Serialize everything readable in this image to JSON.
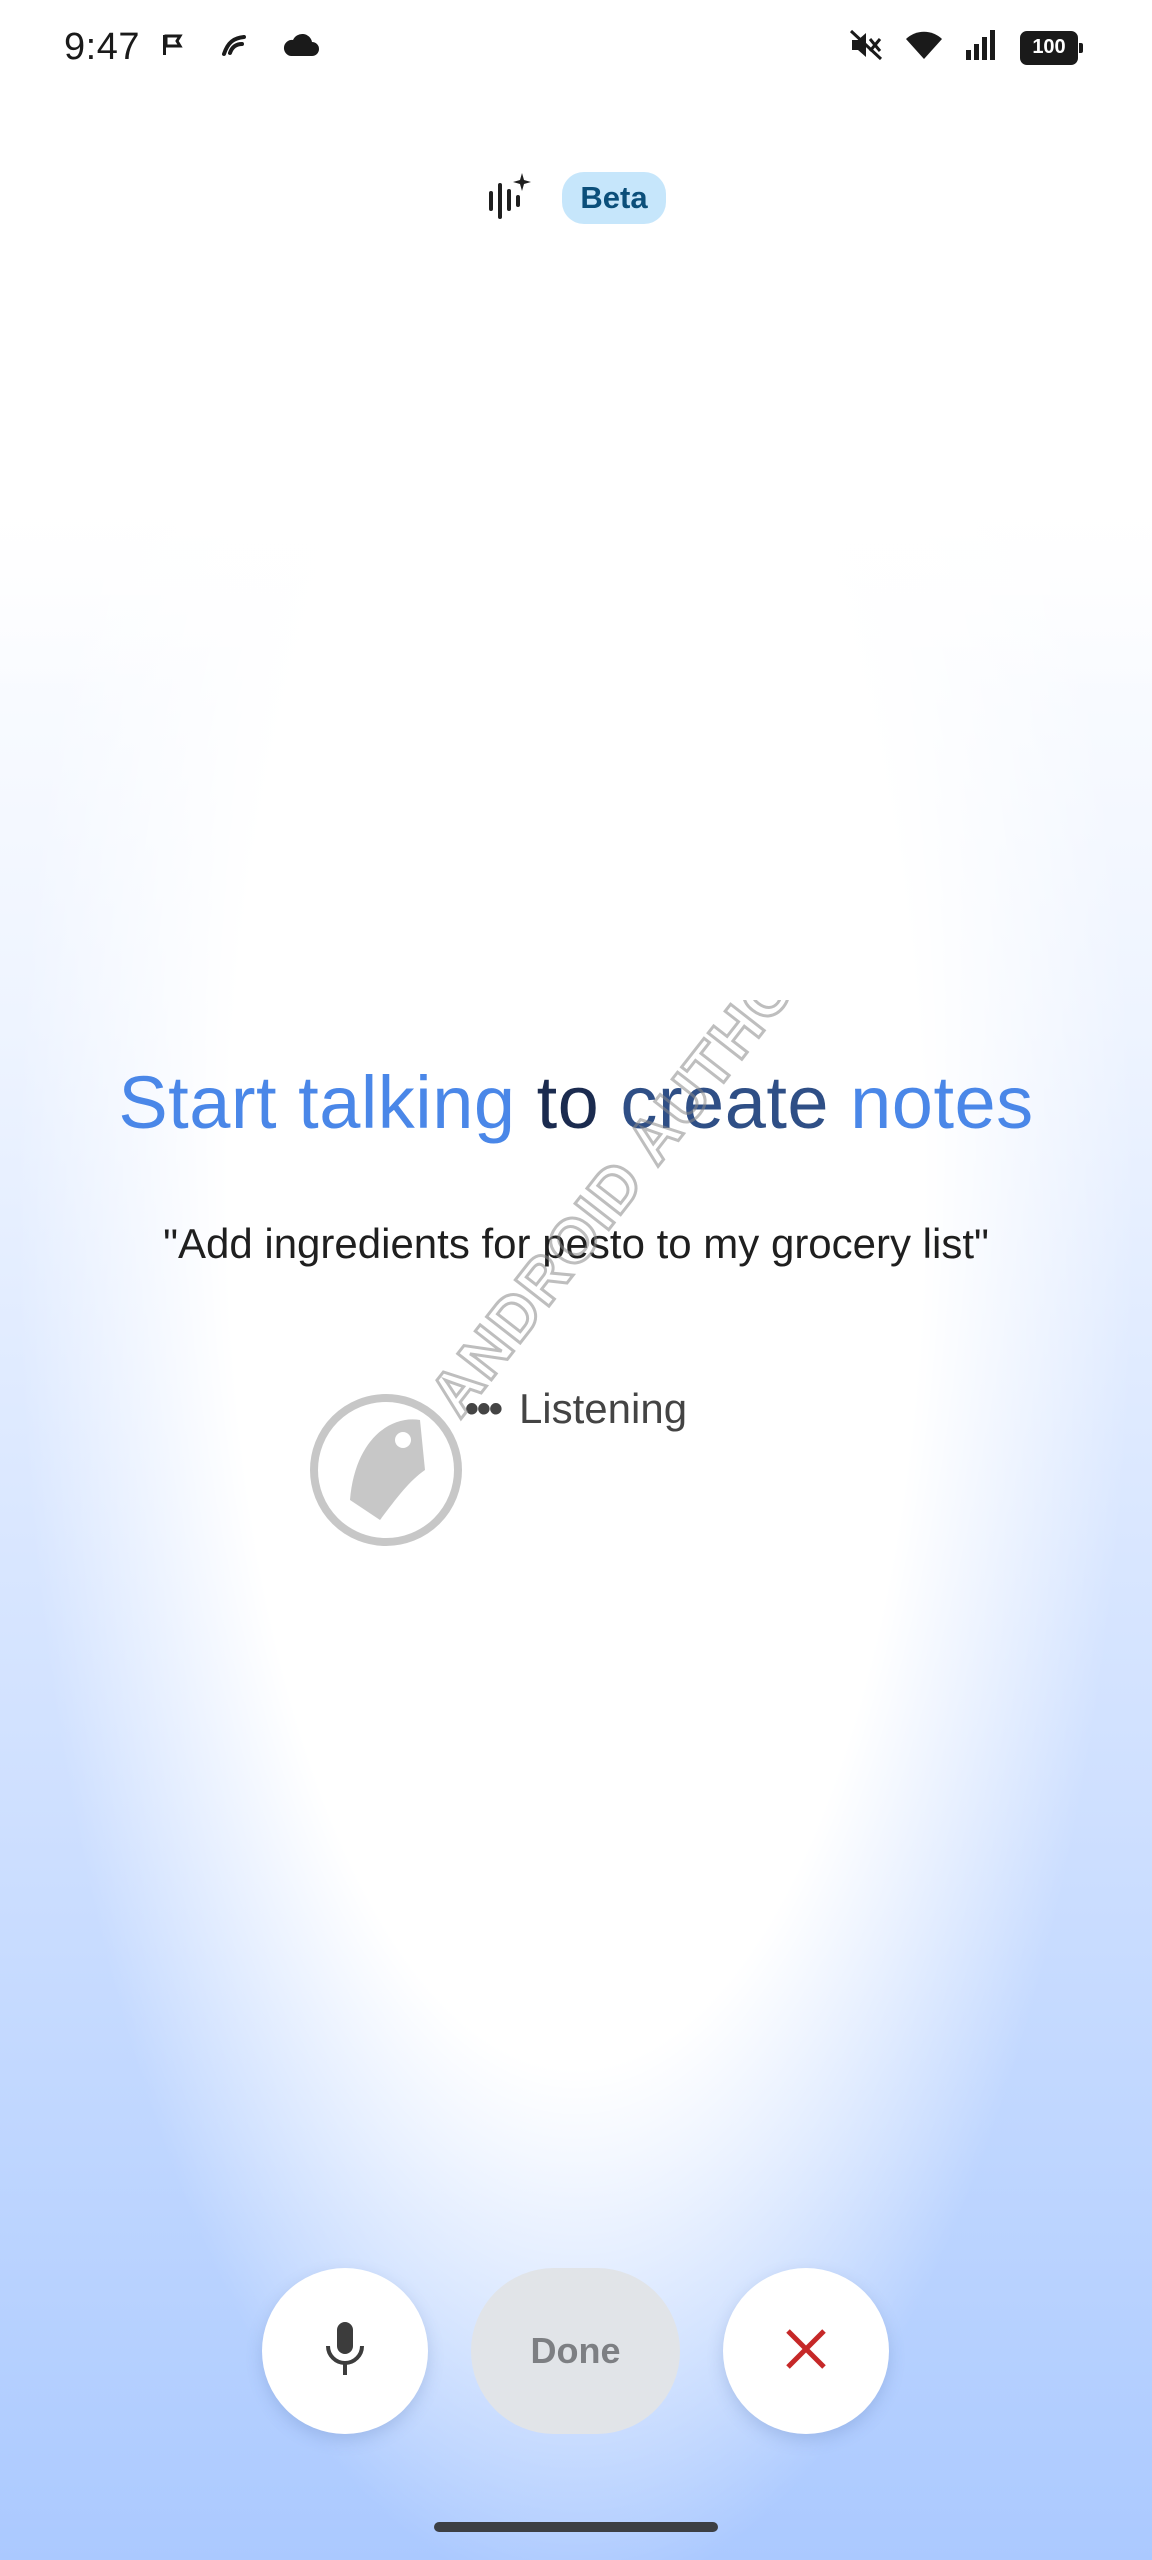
{
  "status_bar": {
    "time": "9:47",
    "left_icons": [
      "flag-icon",
      "fingerprint-sync-icon",
      "cloud-icon"
    ],
    "right_icons": [
      "mute-icon",
      "wifi-icon",
      "signal-icon"
    ],
    "battery": "100"
  },
  "header": {
    "icon": "voice-sparkle-icon",
    "badge": "Beta"
  },
  "headline": {
    "part1": "Start talking",
    "part2": " to ",
    "part3": "create",
    "part4": " notes"
  },
  "example_prompt": "\"Add ingredients for pesto to my grocery list\"",
  "listening": {
    "label": "Listening",
    "indicator": "•••"
  },
  "watermark": {
    "text": "ANDROID AUTHORITY"
  },
  "controls": {
    "mic_icon": "microphone-icon",
    "done_label": "Done",
    "close_icon": "close-icon"
  },
  "colors": {
    "accent_blue": "#4a87e8",
    "badge_bg": "#c6e6fb",
    "close_red": "#c62828"
  }
}
